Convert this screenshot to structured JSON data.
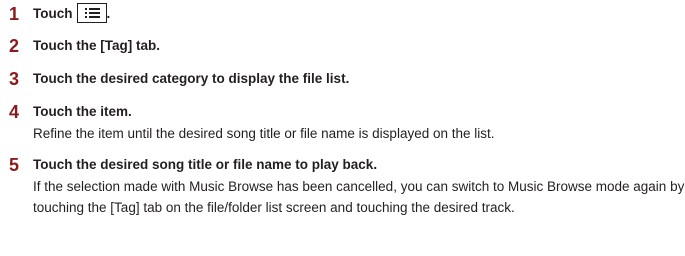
{
  "steps": [
    {
      "number": "1",
      "title": "Touch",
      "title_suffix": "."
    },
    {
      "number": "2",
      "title": "Touch the [Tag] tab."
    },
    {
      "number": "3",
      "title": "Touch the desired category to display the file list."
    },
    {
      "number": "4",
      "title": "Touch the item.",
      "description": "Refine the item until the desired song title or file name is displayed on the list."
    },
    {
      "number": "5",
      "title": "Touch the desired song title or file name to play back.",
      "description": "If the selection made with Music Browse has been cancelled, you can switch to Music Browse mode again by touching the [Tag] tab on the file/folder list screen and touching the desired track."
    }
  ],
  "icons": {
    "menu": "list-menu-icon"
  },
  "colors": {
    "step_number": "#8b1a1c",
    "text": "#231f20"
  }
}
